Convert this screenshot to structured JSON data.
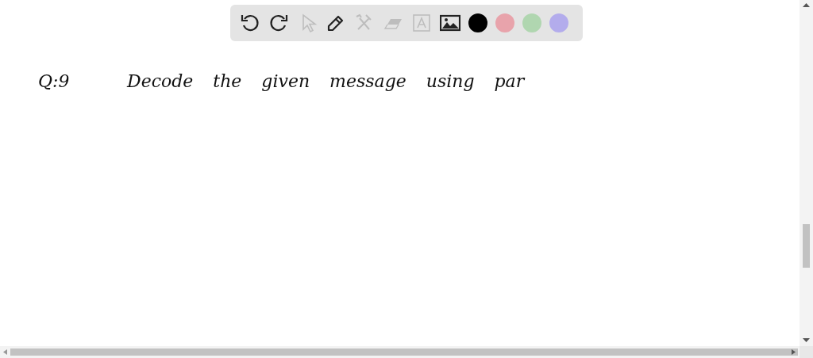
{
  "toolbar": {
    "tools": [
      {
        "kind": "undo",
        "disabled": false
      },
      {
        "kind": "redo",
        "disabled": false
      },
      {
        "kind": "select",
        "disabled": true
      },
      {
        "kind": "pen",
        "disabled": false
      },
      {
        "kind": "tools",
        "disabled": true
      },
      {
        "kind": "eraser",
        "disabled": true
      },
      {
        "kind": "text",
        "disabled": true
      },
      {
        "kind": "image",
        "disabled": false
      }
    ],
    "colors": [
      {
        "color": "#000000"
      },
      {
        "color": "#e8a3ab"
      },
      {
        "color": "#b0d6b0"
      },
      {
        "color": "#b3acec"
      }
    ]
  },
  "canvas": {
    "question_number": "Q:9",
    "text": "Decode the given message using par"
  }
}
